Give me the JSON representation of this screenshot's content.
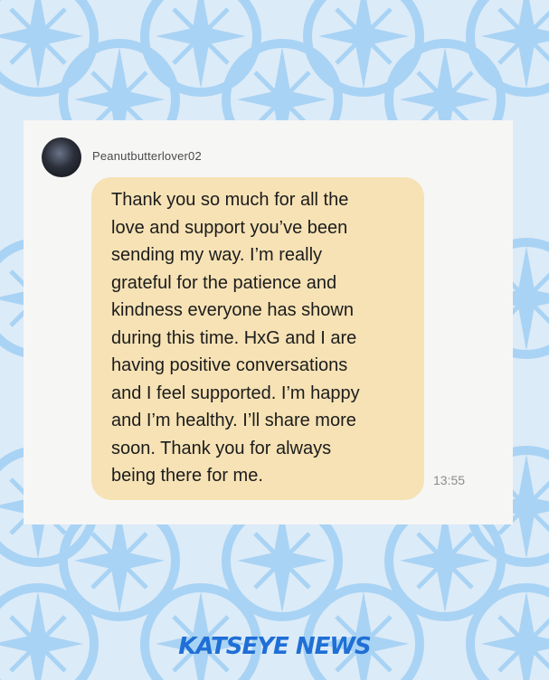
{
  "post": {
    "username": "Peanutbutterlover02",
    "message": "Thank you so much for all the\nlove and support you’ve been\nsending my way. I’m really\ngrateful for the patience and\nkindness everyone has shown\nduring this time.  HxG and I are\nhaving positive conversations\nand I feel supported. I’m happy\nand I’m healthy.  I’ll share more\nsoon. Thank you for always\nbeing there for me.",
    "time": "13:55"
  },
  "branding": {
    "footer": "KATSEYE NEWS"
  },
  "colors": {
    "background": "#dcebf8",
    "pattern": "#a9d3f4",
    "card": "#f6f6f5",
    "bubble": "#f6e2b5",
    "brand": "#1f6fd6"
  },
  "icons": {
    "background_motif": "compass-star-icon",
    "avatar": "user-avatar"
  }
}
